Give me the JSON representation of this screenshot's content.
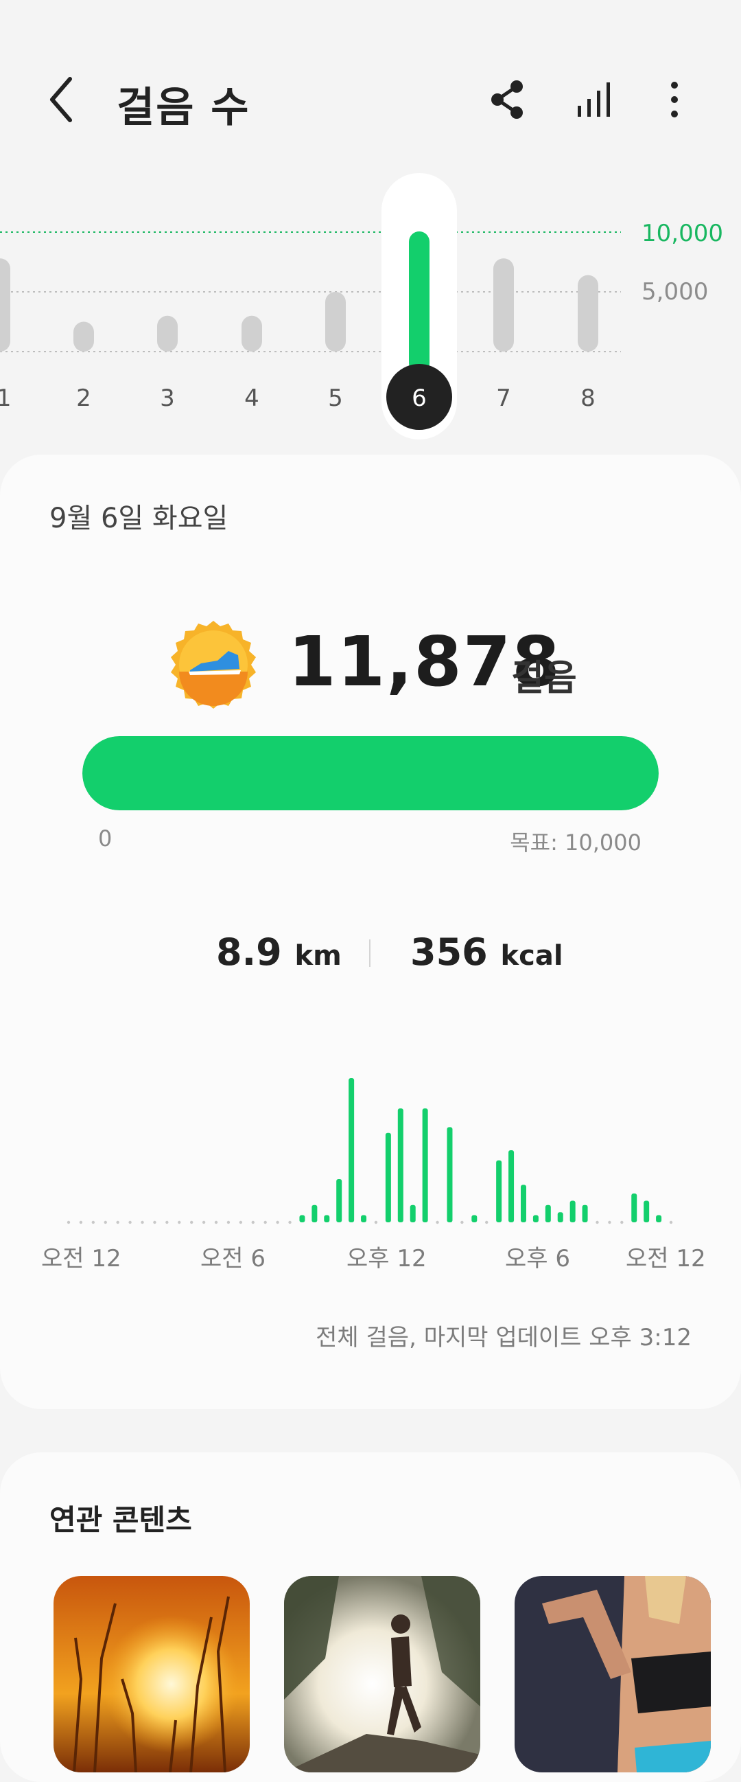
{
  "header": {
    "title": "걸음 수",
    "icons": [
      "back-arrow-icon",
      "share-icon",
      "bar-chart-icon",
      "more-vert-icon"
    ]
  },
  "week_chart": {
    "days": [
      "/1",
      "2",
      "3",
      "4",
      "5",
      "6",
      "7",
      "8"
    ],
    "selected_day": "6",
    "goal_label": "10,000",
    "mid_label": "5,000",
    "values_relative_to_goal": [
      0.78,
      0.25,
      0.3,
      0.3,
      0.5,
      1.19,
      0.78,
      0.64
    ],
    "colors": {
      "bar": "#d0d0d0",
      "selected": "#13cf6c",
      "goal_line": "#18b760"
    }
  },
  "summary": {
    "date": "9월 6일 화요일",
    "steps": "11,878",
    "steps_unit": "걸음",
    "progress_fraction": 1.0,
    "progress_min": "0",
    "progress_goal": "목표: 10,000",
    "distance_value": "8.9",
    "distance_unit": "km",
    "calories_value": "356",
    "calories_unit": "kcal"
  },
  "hourly_chart": {
    "x_labels": [
      "오전 12",
      "오전 6",
      "오후 12",
      "오후 6",
      "오전 12"
    ],
    "update_text": "전체 걸음, 마지막 업데이트 오후 3:12",
    "relative_heights": [
      0,
      0,
      0,
      0,
      0,
      0,
      0,
      0,
      0,
      0,
      0,
      0,
      0,
      0,
      0,
      0,
      0,
      0,
      0,
      0.05,
      0.12,
      0.05,
      0.3,
      1.0,
      0.05,
      0,
      0.62,
      0.79,
      0.12,
      0.79,
      0,
      0.66,
      0,
      0.05,
      0,
      0.43,
      0.5,
      0.26,
      0.05,
      0.12,
      0.07,
      0.15,
      0.12,
      0,
      0,
      0,
      0.2,
      0.15,
      0.05,
      0
    ]
  },
  "related": {
    "title": "연관 콘텐츠",
    "thumbnails": [
      "sunset-image",
      "runner-image",
      "fitness-woman-image"
    ]
  }
}
